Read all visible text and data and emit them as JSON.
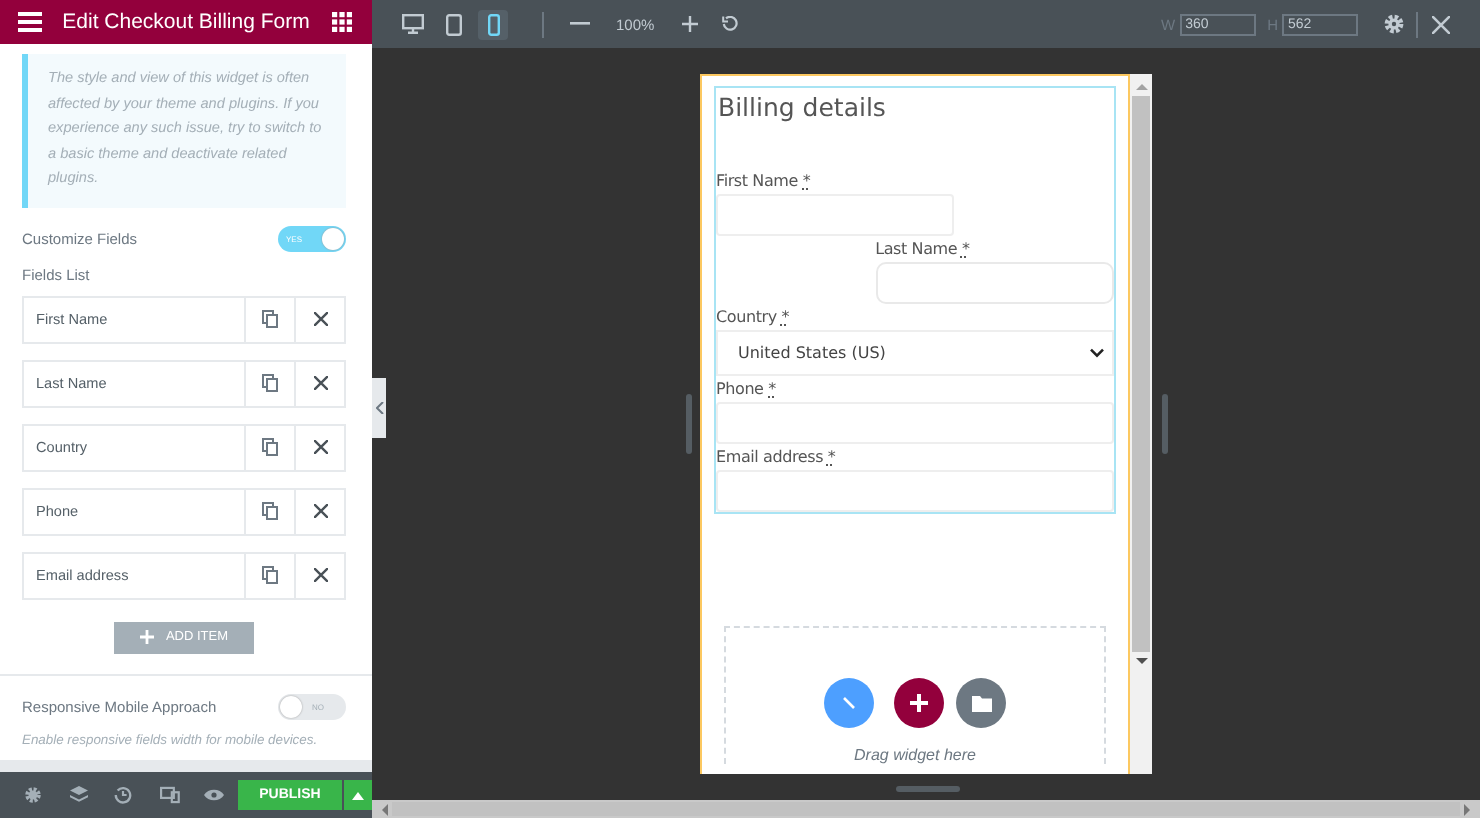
{
  "panel": {
    "title": "Edit Checkout Billing Form",
    "notice": "The style and view of this widget is often affected by your theme and plugins. If you experience any such issue, try to switch to a basic theme and deactivate related plugins.",
    "customize_fields": {
      "label": "Customize Fields",
      "on": true,
      "text": "YES"
    },
    "fields_list_label": "Fields List",
    "fields": [
      {
        "label": "First Name"
      },
      {
        "label": "Last Name"
      },
      {
        "label": "Country"
      },
      {
        "label": "Phone"
      },
      {
        "label": "Email address"
      }
    ],
    "add_item": "ADD ITEM",
    "responsive": {
      "label": "Responsive Mobile Approach",
      "on": false,
      "text": "NO",
      "description": "Enable responsive fields width for mobile devices."
    }
  },
  "footer": {
    "publish": "PUBLISH"
  },
  "toolbar": {
    "devices": [
      {
        "kind": "desktop",
        "selected": false
      },
      {
        "kind": "tablet",
        "selected": false
      },
      {
        "kind": "mobile",
        "selected": true
      }
    ],
    "zoom": "100%",
    "width": {
      "label": "W",
      "value": "360"
    },
    "height": {
      "label": "H",
      "value": "562"
    }
  },
  "form": {
    "title": "Billing details",
    "fields": [
      {
        "label": "First Name",
        "required": "*",
        "kind": "input",
        "half": true
      },
      {
        "label": "Last Name",
        "required": "*",
        "kind": "input",
        "half": true
      },
      {
        "label": "Country",
        "required": "*",
        "kind": "select",
        "value": "United States (US)",
        "half": false
      },
      {
        "label": "Phone",
        "required": "*",
        "kind": "input",
        "half": false
      },
      {
        "label": "Email address",
        "required": "*",
        "kind": "input",
        "half": false
      }
    ]
  },
  "drop_zone": {
    "text": "Drag widget here"
  }
}
